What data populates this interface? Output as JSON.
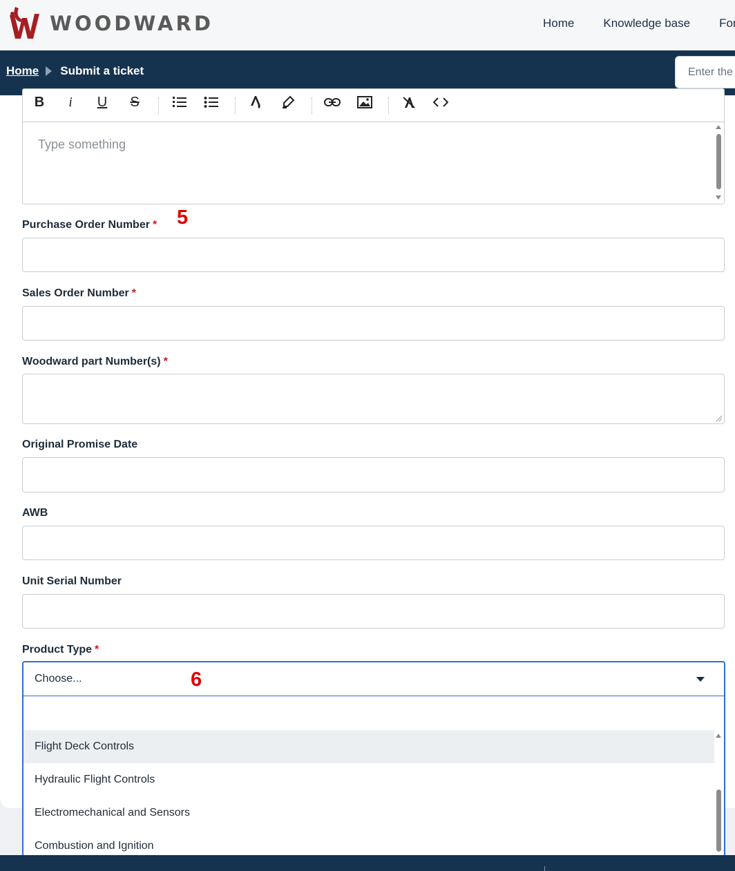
{
  "header": {
    "brand": "WOODWARD",
    "logo_icon": "woodward-w-logo-icon",
    "nav": [
      "Home",
      "Knowledge base",
      "Forums"
    ]
  },
  "breadcrumb": {
    "home": "Home",
    "current": "Submit a ticket"
  },
  "search": {
    "placeholder": "Enter the search term"
  },
  "editor": {
    "toolbar_icons": [
      "bold-icon",
      "italic-icon",
      "underline-icon",
      "strikethrough-icon",
      "ordered-list-icon",
      "bullet-list-icon",
      "text-color-icon",
      "highlight-icon",
      "link-icon",
      "image-icon",
      "clear-format-icon",
      "code-icon"
    ],
    "toolbar_glyphs": {
      "bold": "B",
      "italic": "i",
      "underline": "U",
      "strike": "S"
    },
    "placeholder": "Type something"
  },
  "fields": {
    "po_number": {
      "label": "Purchase Order Number",
      "required": "*"
    },
    "sales_order": {
      "label": "Sales Order Number",
      "required": "*"
    },
    "part_numbers": {
      "label": "Woodward part Number(s)",
      "required": "*"
    },
    "promise_date": {
      "label": "Original Promise Date"
    },
    "awb": {
      "label": "AWB"
    },
    "serial": {
      "label": "Unit Serial Number"
    },
    "product_type": {
      "label": "Product Type",
      "required": "*"
    }
  },
  "select": {
    "value": "Choose...",
    "options": [
      "Flight Deck Controls",
      "Hydraulic Flight Controls",
      "Electromechanical and Sensors",
      "Combustion and Ignition"
    ],
    "highlighted_index": 0
  },
  "annotations": {
    "marker_5": "5",
    "marker_6": "6"
  },
  "colors": {
    "brand_red": "#a51e22",
    "header_navy": "#15334f",
    "required_red": "#c81d25",
    "focus_blue": "#2c6ed8"
  }
}
